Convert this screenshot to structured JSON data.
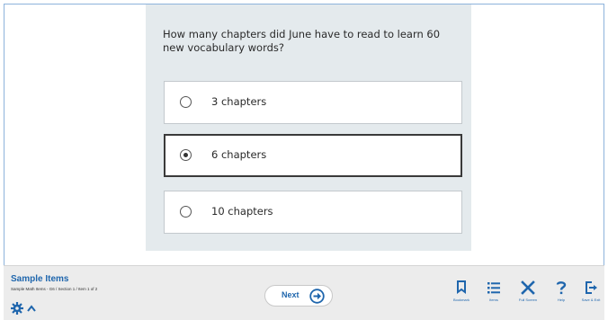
{
  "question": {
    "text": "How many chapters did June have to read to learn 60 new vocabulary words?",
    "choices": [
      {
        "label": "3 chapters",
        "selected": false
      },
      {
        "label": "6 chapters",
        "selected": true
      },
      {
        "label": "10 chapters",
        "selected": false
      }
    ]
  },
  "footer": {
    "title": "Sample Items",
    "breadcrumb": "Sample Math Items - G6 / Section 1 / Item 1 of 2",
    "next_label": "Next",
    "tools": [
      {
        "label": "Bookmark",
        "icon": "bookmark-icon"
      },
      {
        "label": "Items",
        "icon": "list-icon"
      },
      {
        "label": "Full Screen",
        "icon": "full-screen-icon"
      },
      {
        "label": "Help",
        "icon": "help-icon"
      },
      {
        "label": "Save & Exit",
        "icon": "exit-icon"
      }
    ]
  },
  "colors": {
    "accent": "#1f66ad",
    "panel": "#e4eaed",
    "footer": "#ececec"
  }
}
